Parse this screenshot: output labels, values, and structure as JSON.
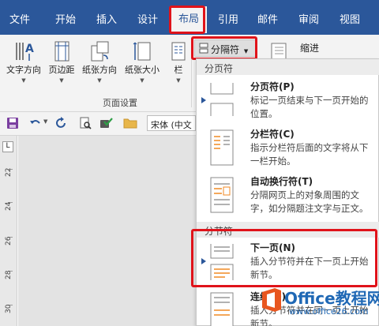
{
  "tabs": [
    "文件",
    "开始",
    "插入",
    "设计",
    "布局",
    "引用",
    "邮件",
    "审阅",
    "视图"
  ],
  "active_tab": "布局",
  "ribbon": {
    "buttons": [
      "文字方向",
      "页边距",
      "纸张方向",
      "纸张大小",
      "栏"
    ],
    "group_label": "页面设置",
    "breaks_button": "分隔符",
    "indent_label": "缩进"
  },
  "qat": {
    "font_name": "宋体 (中文"
  },
  "ruler": {
    "ticks": [
      "22",
      "24",
      "26",
      "28",
      "30"
    ],
    "corner": "L"
  },
  "dropdown": {
    "page_breaks_header": "分页符",
    "section_breaks_header": "分节符",
    "items": [
      {
        "title": "分页符(P)",
        "desc": "标记一页结束与下一页开始的位置。"
      },
      {
        "title": "分栏符(C)",
        "desc": "指示分栏符后面的文字将从下一栏开始。"
      },
      {
        "title": "自动换行符(T)",
        "desc": "分隔网页上的对象周围的文字，如分隔题注文字与正文。"
      },
      {
        "title": "下一页(N)",
        "desc": "插入分节符并在下一页上开始新节。"
      },
      {
        "title": "连续(O)",
        "desc": "插入分节符并在同一页上开始新节。"
      }
    ]
  },
  "watermark": {
    "brand": "Office教程网",
    "url": "www.office26.com"
  },
  "colors": {
    "tab_bar": "#2b579a",
    "highlight": "#e0131a",
    "ribbon_bg": "#f3f3f3"
  }
}
